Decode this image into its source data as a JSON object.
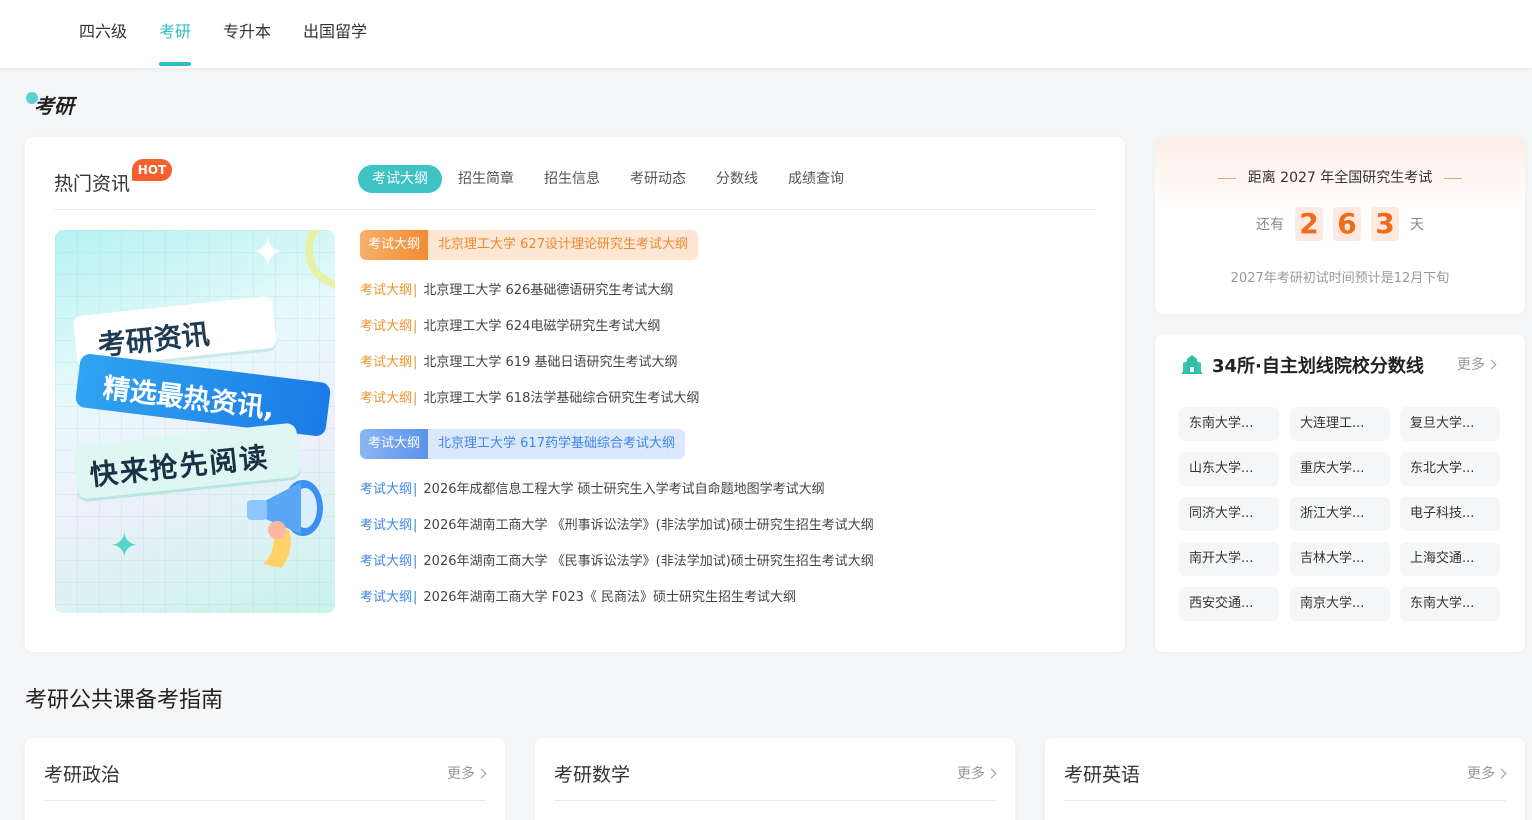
{
  "nav": {
    "tabs": [
      {
        "label": "四六级"
      },
      {
        "label": "考研"
      },
      {
        "label": "专升本"
      },
      {
        "label": "出国留学"
      }
    ]
  },
  "section_logo": "考研",
  "news": {
    "title": "热门资讯",
    "badge": "HOT",
    "tabs": [
      "考试大纲",
      "招生简章",
      "招生信息",
      "考研动态",
      "分数线",
      "成绩查询"
    ],
    "banner": {
      "line1": "考研资讯",
      "line2": "精选最热资讯,",
      "line3": "快来抢先阅读"
    },
    "tag": "考试大纲",
    "sep": "|",
    "group1": {
      "featured": "北京理工大学 627设计理论研究生考试大纲",
      "items": [
        "北京理工大学 626基础德语研究生考试大纲",
        "北京理工大学 624电磁学研究生考试大纲",
        "北京理工大学 619 基础日语研究生考试大纲",
        "北京理工大学 618法学基础综合研究生考试大纲"
      ]
    },
    "group2": {
      "featured": "北京理工大学 617药学基础综合考试大纲",
      "items": [
        "2026年成都信息工程大学 硕士研究生入学考试自命题地图学考试大纲",
        "2026年湖南工商大学 《刑事诉讼法学》(非法学加试)硕士研究生招生考试大纲",
        "2026年湖南工商大学 《民事诉讼法学》(非法学加试)硕士研究生招生考试大纲",
        "2026年湖南工商大学 F023《 民商法》硕士研究生招生考试大纲"
      ]
    }
  },
  "countdown": {
    "title": "距离 2027 年全国研究生考试",
    "prefix": "还有",
    "digits": [
      "2",
      "6",
      "3"
    ],
    "suffix": "天",
    "note": "2027年考研初试时间预计是12月下旬"
  },
  "schools": {
    "title": "34所·自主划线院校分数线",
    "more": "更多",
    "items": [
      "东南大学...",
      "大连理工...",
      "复旦大学...",
      "山东大学...",
      "重庆大学...",
      "东北大学...",
      "同济大学...",
      "浙江大学...",
      "电子科技...",
      "南开大学...",
      "吉林大学...",
      "上海交通...",
      "西安交通...",
      "南京大学...",
      "东南大学..."
    ]
  },
  "guide": {
    "heading": "考研公共课备考指南",
    "more": "更多",
    "cards": [
      {
        "title": "考研政治"
      },
      {
        "title": "考研数学"
      },
      {
        "title": "考研英语"
      }
    ]
  },
  "colors": {
    "accent": "#2fbfc1",
    "hot": "#f5612e",
    "tag_orange": "#f0932b",
    "tag_blue": "#3f86e6",
    "countdown_digit": "#f06a1a"
  }
}
